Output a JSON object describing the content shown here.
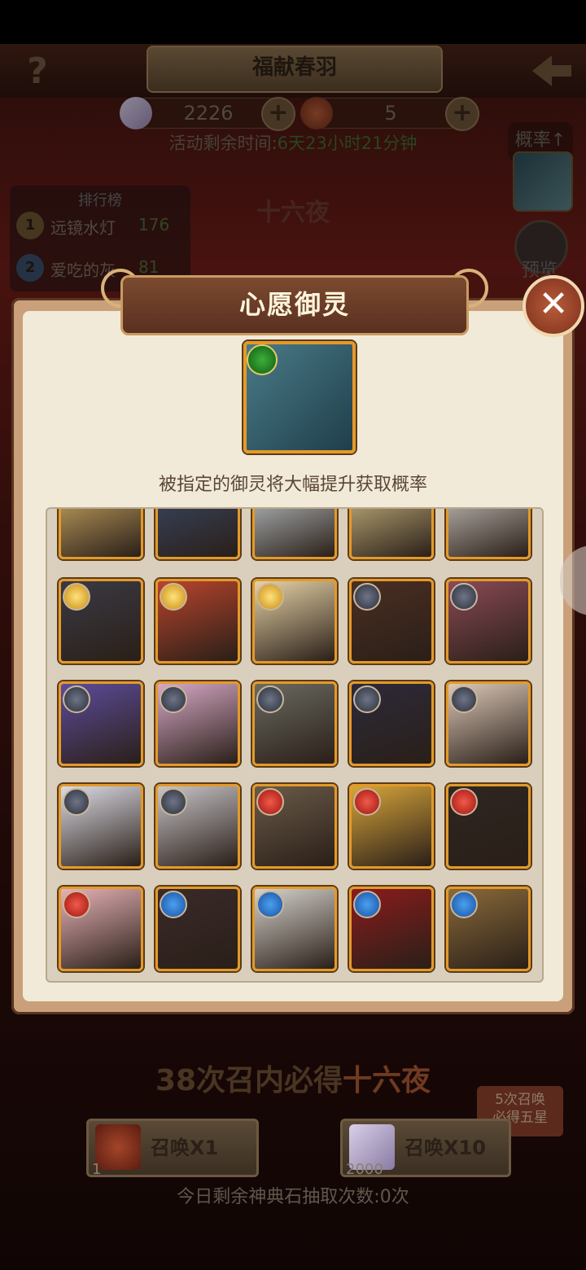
{
  "header": {
    "title": "福献春羽"
  },
  "currency": {
    "gems": "2226",
    "tickets": "5"
  },
  "timer": {
    "label": "活动剩余时间:",
    "value": "6天23小时21分钟"
  },
  "ranking": {
    "title": "排行榜",
    "rows": [
      {
        "rank": "1",
        "name": "远镜水灯",
        "score": "176"
      },
      {
        "rank": "2",
        "name": "爱吃的灰",
        "score": "81"
      }
    ]
  },
  "featured_name": "十六夜",
  "side": {
    "prob_label": "概率↑",
    "preview_label": "预览"
  },
  "modal": {
    "title": "心愿御灵",
    "caption": "被指定的御灵将大幅提升获取概率",
    "cards": [
      {
        "badge": "none",
        "color": "#d8b36a"
      },
      {
        "badge": "none",
        "color": "#3a4a6a"
      },
      {
        "badge": "none",
        "color": "#c9d2d6"
      },
      {
        "badge": "none",
        "color": "#d8c48a"
      },
      {
        "badge": "none",
        "color": "#d6d0cc"
      },
      {
        "badge": "gold",
        "color": "#3a3a44"
      },
      {
        "badge": "gold",
        "color": "#b8442c"
      },
      {
        "badge": "gold",
        "color": "#e6d2a6"
      },
      {
        "badge": "dark",
        "color": "#4b2e22"
      },
      {
        "badge": "dark",
        "color": "#8a4a56"
      },
      {
        "badge": "dark",
        "color": "#5c4c9a"
      },
      {
        "badge": "dark",
        "color": "#d6a8c6"
      },
      {
        "badge": "dark",
        "color": "#6a6a60"
      },
      {
        "badge": "dark",
        "color": "#2c2a3a"
      },
      {
        "badge": "dark",
        "color": "#dcc8b8"
      },
      {
        "badge": "dark",
        "color": "#dcdce6"
      },
      {
        "badge": "dark",
        "color": "#c8c4c8"
      },
      {
        "badge": "red",
        "color": "#6a5a48"
      },
      {
        "badge": "red",
        "color": "#d6a43a"
      },
      {
        "badge": "red",
        "color": "#2e2622"
      },
      {
        "badge": "red",
        "color": "#e6b2b6"
      },
      {
        "badge": "blue",
        "color": "#3a2a2a"
      },
      {
        "badge": "blue",
        "color": "#d6d2cc"
      },
      {
        "badge": "blue",
        "color": "#8a1c1c"
      },
      {
        "badge": "blue",
        "color": "#8a6a3a"
      }
    ]
  },
  "bottom": {
    "guarantee_prefix": "38次召内必得",
    "guarantee_hero": "十六夜",
    "five_star_line1": "5次召唤",
    "five_star_line2": "必得五星",
    "summon1_label": "召唤X1",
    "summon1_cost": "1",
    "summon10_label": "召唤X10",
    "summon10_cost": "2000",
    "remaining": "今日剩余神典石抽取次数:0次"
  }
}
